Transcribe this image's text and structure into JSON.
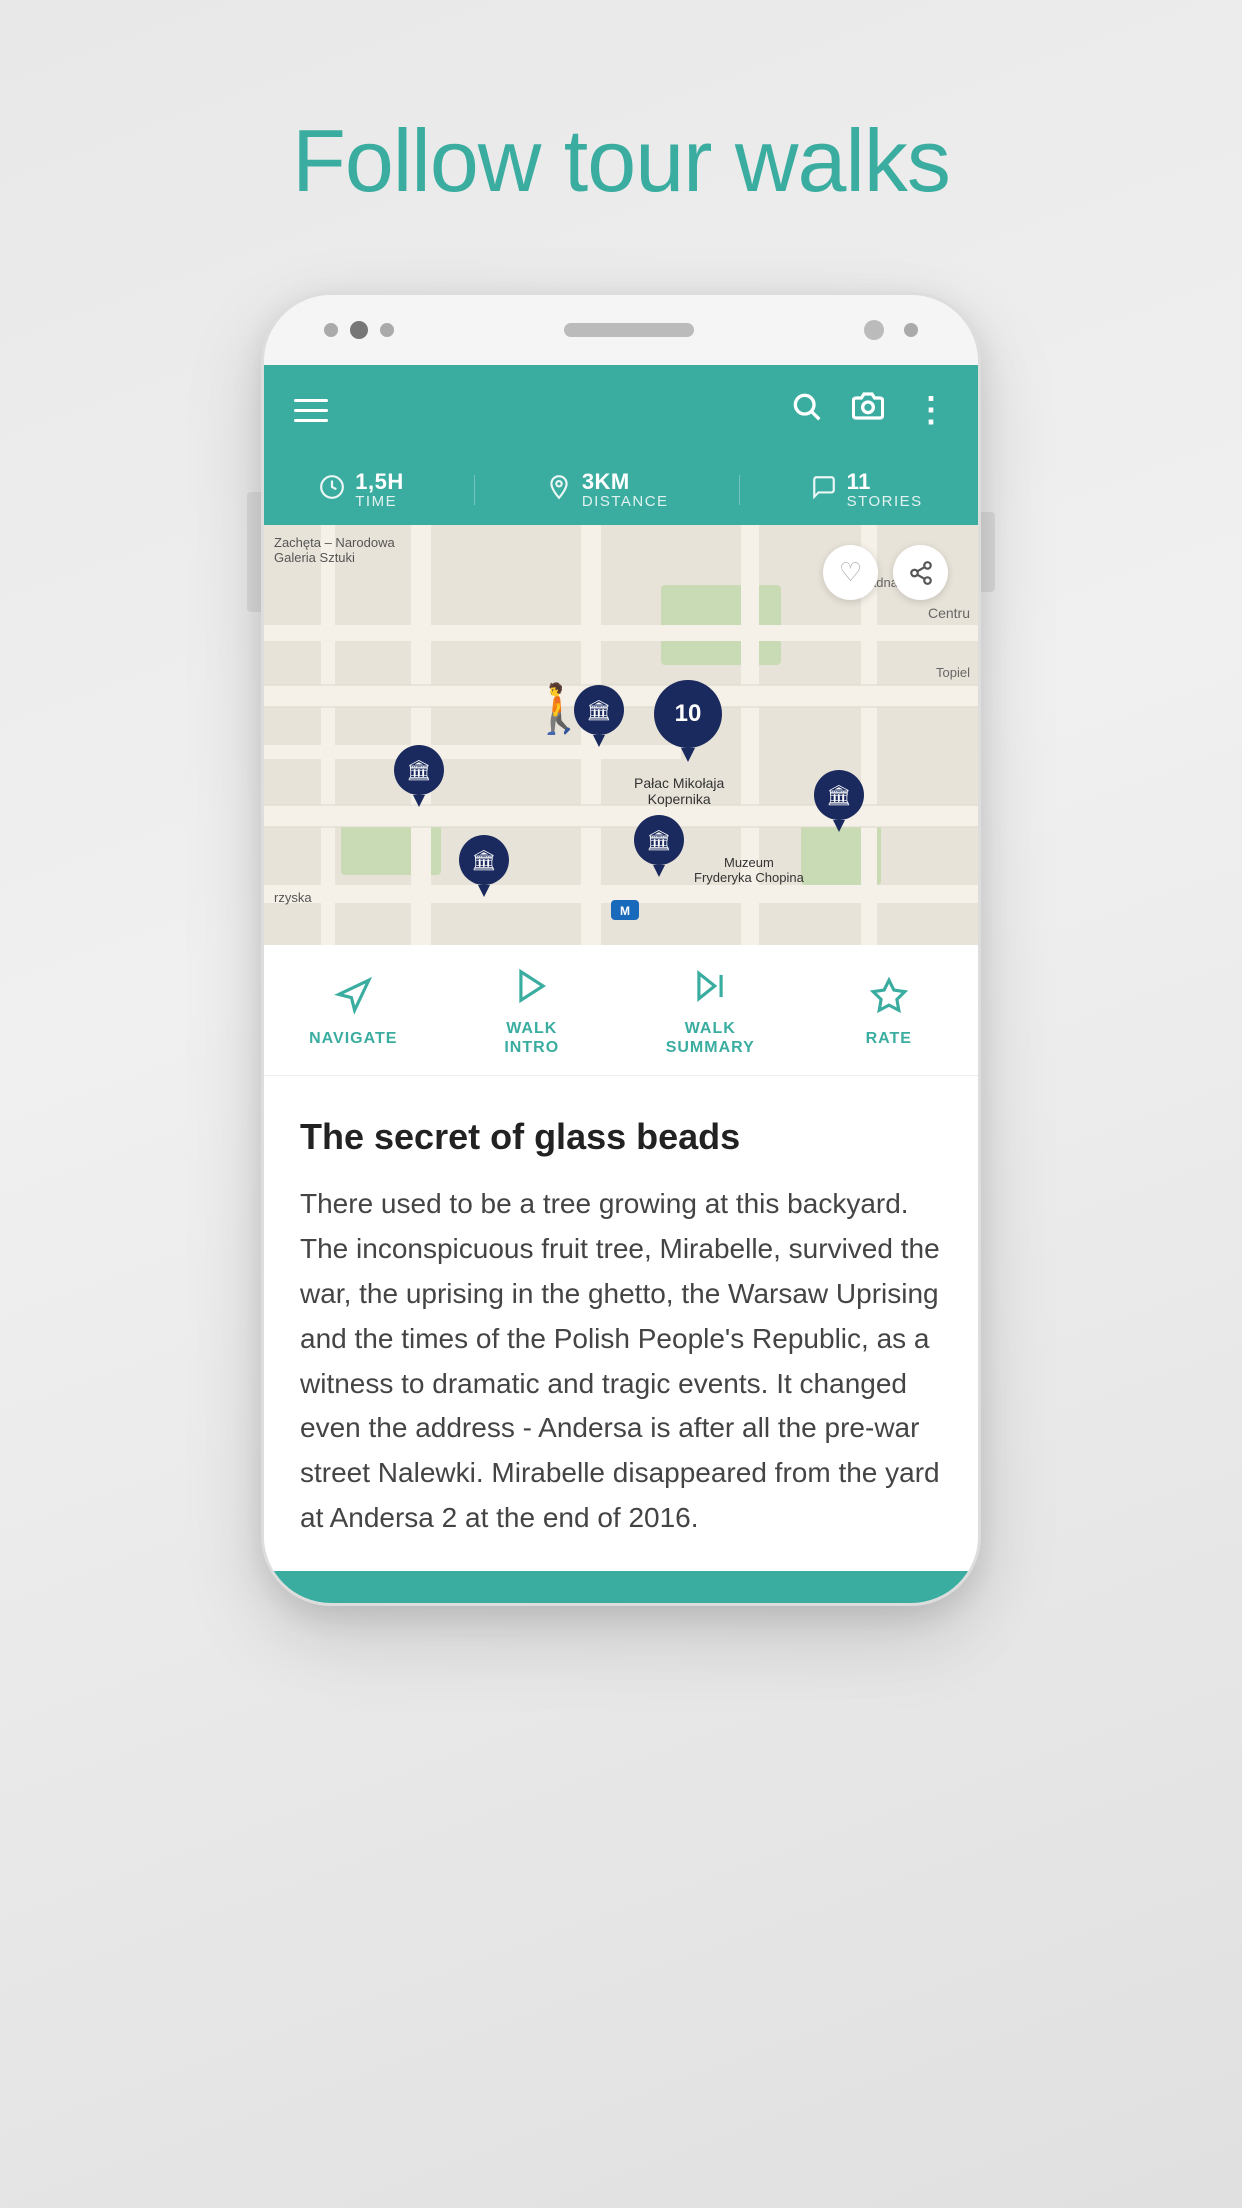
{
  "page": {
    "title": "Follow tour walks"
  },
  "topbar": {
    "search_icon": "🔍",
    "camera_icon": "📷",
    "more_icon": "⋮"
  },
  "stats": {
    "time_value": "1,5H",
    "time_label": "TIME",
    "distance_value": "3KM",
    "distance_label": "DISTANCE",
    "stories_value": "11",
    "stories_label": "STORIES"
  },
  "map": {
    "cluster_number": "10",
    "heart_icon": "♡",
    "share_icon": "⋲"
  },
  "action_tabs": [
    {
      "id": "navigate",
      "label": "NAVIGATE",
      "icon": "navigate"
    },
    {
      "id": "walk-intro",
      "label": "WALK\nINTRO",
      "icon": "play"
    },
    {
      "id": "walk-summary",
      "label": "WALK\nSUMMARY",
      "icon": "skip"
    },
    {
      "id": "rate",
      "label": "RATE",
      "icon": "star"
    }
  ],
  "content": {
    "title": "The secret of glass beads",
    "body": "There used to be a tree growing at this backyard. The inconspicuous fruit tree, Mirabelle, survived the war, the uprising in the ghetto, the Warsaw Uprising and the times of the Polish People's Republic, as a witness to dramatic and tragic events. It changed even the address - Andersa is after all the pre-war street Nalewki. Mirabelle disappeared from the yard at Andersa 2 at the end of 2016."
  },
  "colors": {
    "teal": "#3aada0",
    "dark_navy": "#1a2a5e",
    "text_dark": "#222222",
    "text_body": "#444444",
    "map_bg": "#e8e3d9",
    "map_green": "#c8dbb4"
  }
}
